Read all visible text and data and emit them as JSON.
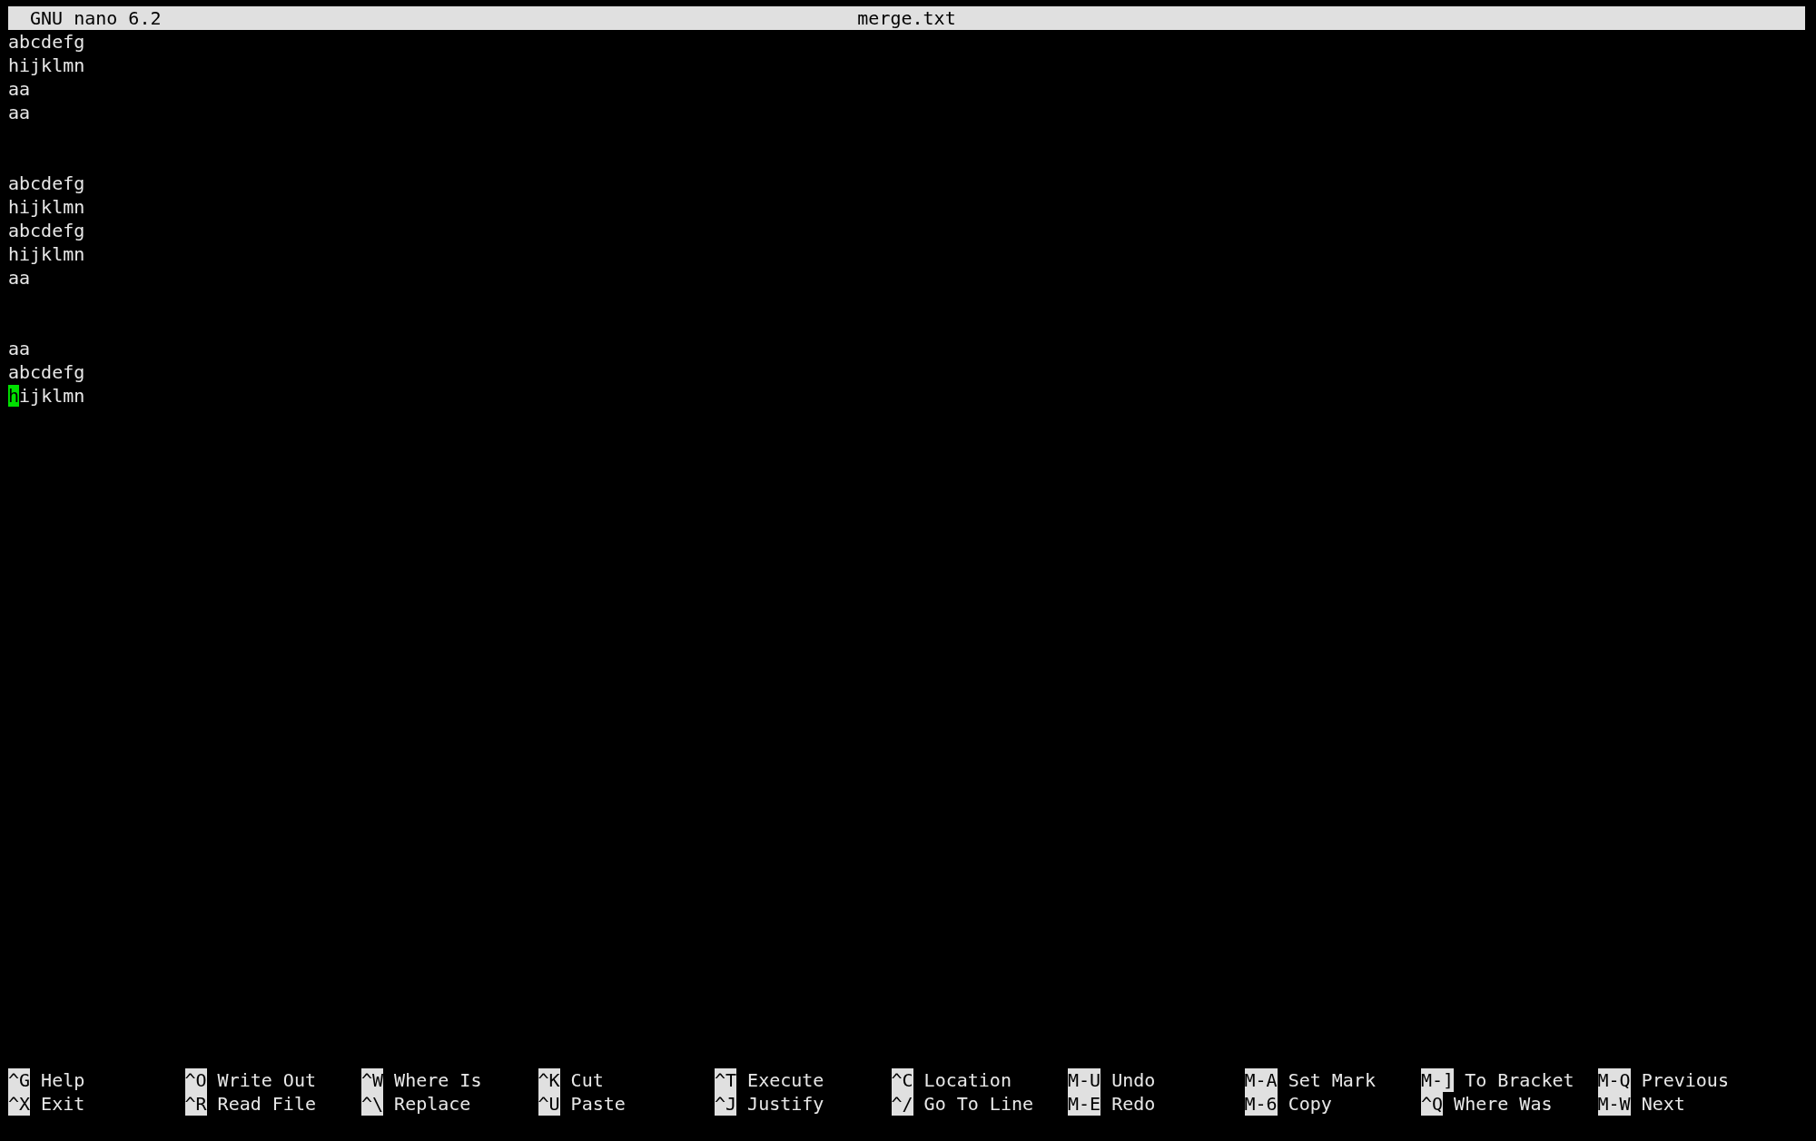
{
  "title_bar": {
    "app": "GNU nano 6.2",
    "file": "merge.txt"
  },
  "blocks": [
    [
      {
        "text": "abcdefg",
        "cursor": false
      },
      {
        "text": "hijklmn",
        "cursor": false
      },
      {
        "text": "aa",
        "cursor": false
      },
      {
        "text": "aa",
        "cursor": false
      }
    ],
    [
      {
        "text": "abcdefg",
        "cursor": false
      },
      {
        "text": "hijklmn",
        "cursor": false
      },
      {
        "text": "abcdefg",
        "cursor": false
      },
      {
        "text": "hijklmn",
        "cursor": false
      },
      {
        "text": "aa",
        "cursor": false
      }
    ],
    [
      {
        "text": "aa",
        "cursor": false
      },
      {
        "text": "abcdefg",
        "cursor": false
      },
      {
        "text": "hijklmn",
        "cursor": true
      }
    ]
  ],
  "shortcuts": [
    [
      {
        "key": "^G",
        "label": "Help"
      },
      {
        "key": "^X",
        "label": "Exit"
      }
    ],
    [
      {
        "key": "^O",
        "label": "Write Out"
      },
      {
        "key": "^R",
        "label": "Read File"
      }
    ],
    [
      {
        "key": "^W",
        "label": "Where Is"
      },
      {
        "key": "^\\",
        "label": "Replace"
      }
    ],
    [
      {
        "key": "^K",
        "label": "Cut"
      },
      {
        "key": "^U",
        "label": "Paste"
      }
    ],
    [
      {
        "key": "^T",
        "label": "Execute"
      },
      {
        "key": "^J",
        "label": "Justify"
      }
    ],
    [
      {
        "key": "^C",
        "label": "Location"
      },
      {
        "key": "^/",
        "label": "Go To Line"
      }
    ],
    [
      {
        "key": "M-U",
        "label": "Undo"
      },
      {
        "key": "M-E",
        "label": "Redo"
      }
    ],
    [
      {
        "key": "M-A",
        "label": "Set Mark"
      },
      {
        "key": "M-6",
        "label": "Copy"
      }
    ],
    [
      {
        "key": "M-]",
        "label": "To Bracket"
      },
      {
        "key": "^Q",
        "label": "Where Was"
      }
    ],
    [
      {
        "key": "M-Q",
        "label": "Previous"
      },
      {
        "key": "M-W",
        "label": "Next"
      }
    ]
  ]
}
